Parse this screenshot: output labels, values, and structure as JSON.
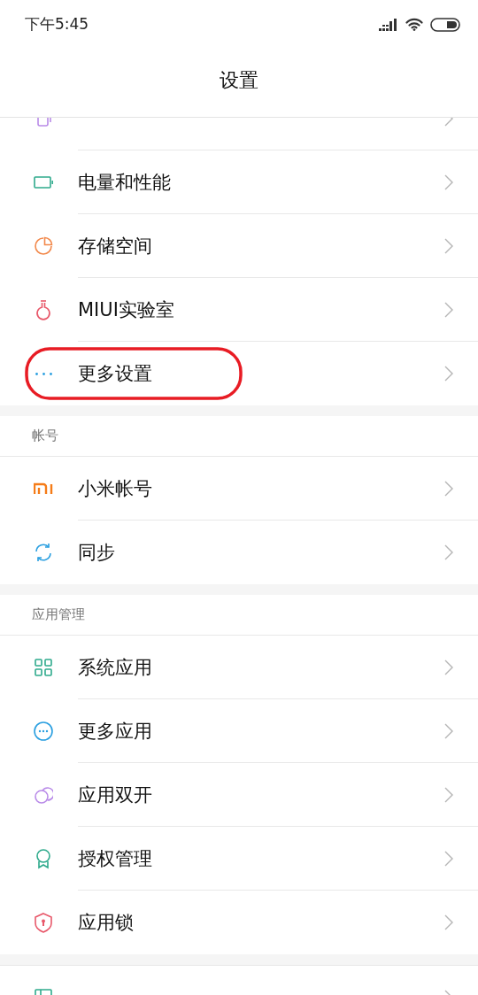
{
  "status_bar": {
    "time": "下午5:45"
  },
  "header": {
    "title": "设置"
  },
  "groups": [
    {
      "items": [
        {
          "highlighted": false
        },
        {
          "label": "电量和性能",
          "highlighted": false
        },
        {
          "label": "存储空间",
          "highlighted": false
        },
        {
          "label": "MIUI实验室",
          "highlighted": false
        },
        {
          "label": "更多设置",
          "highlighted": true
        }
      ]
    },
    {
      "title": "帐号",
      "items": [
        {
          "label": "小米帐号",
          "highlighted": false
        },
        {
          "label": "同步",
          "highlighted": false
        }
      ]
    },
    {
      "title": "应用管理",
      "items": [
        {
          "label": "系统应用",
          "highlighted": false
        },
        {
          "label": "更多应用",
          "highlighted": false
        },
        {
          "label": "应用双开",
          "highlighted": false
        },
        {
          "label": "授权管理",
          "highlighted": false
        },
        {
          "label": "应用锁",
          "highlighted": false
        }
      ]
    },
    {
      "items": [
        {
          "highlighted": false
        }
      ]
    }
  ]
}
